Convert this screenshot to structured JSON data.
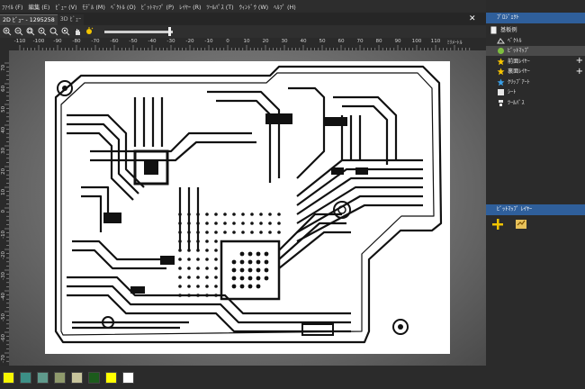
{
  "menubar": [
    "ﾌｧｲﾙ (F)",
    "編集 (E)",
    "ﾋﾞｭｰ (V)",
    "ﾓﾃﾞﾙ (M)",
    "ﾍﾞｸﾄﾙ (O)",
    "ﾋﾞｯﾄﾏｯﾌﾟ (P)",
    "ﾚｲﾔｰ (R)",
    "ﾂｰﾙﾊﾟｽ (T)",
    "ｳｨﾝﾄﾞｳ (W)",
    "ﾍﾙﾌﾟ (H)"
  ],
  "tabs": [
    {
      "label": "2D ﾋﾞｭｰ - 1295258",
      "active": true
    },
    {
      "label": "3D ﾋﾞｭｰ",
      "active": false
    }
  ],
  "ruler": {
    "h_labels": [
      "-110",
      "-100",
      "-90",
      "-80",
      "-70",
      "-60",
      "-50",
      "-40",
      "-30",
      "-20",
      "-10",
      "0",
      "10",
      "20",
      "30",
      "40",
      "50",
      "60",
      "70",
      "80",
      "90",
      "100",
      "110",
      "ﾐﾘﾒｰﾄﾙ"
    ],
    "v_labels": [
      "70",
      "60",
      "50",
      "40",
      "30",
      "20",
      "10",
      "0",
      "-10",
      "-20",
      "-30",
      "-40",
      "-50",
      "-60",
      "-70"
    ]
  },
  "project_panel": {
    "title": "ﾌﾟﾛｼﾞｪｸﾄ",
    "items": [
      {
        "label": "基板例",
        "icon": "document-icon",
        "indent": 0,
        "selected": false,
        "plus": false
      },
      {
        "label": "ﾍﾞｸﾄﾙ",
        "icon": "vector-icon",
        "indent": 1,
        "selected": false,
        "plus": false
      },
      {
        "label": "ﾋﾞｯﾄﾏｯﾌﾟ",
        "icon": "bitmap-icon",
        "indent": 1,
        "selected": true,
        "plus": false
      },
      {
        "label": "前面ﾚｲﾔｰ",
        "icon": "star-icon",
        "indent": 1,
        "selected": false,
        "plus": true
      },
      {
        "label": "裏面ﾚｲﾔｰ",
        "icon": "star-icon",
        "indent": 1,
        "selected": false,
        "plus": true
      },
      {
        "label": "ｸﾘｯﾌﾟｱｰﾄ",
        "icon": "star-blue-icon",
        "indent": 1,
        "selected": false,
        "plus": false
      },
      {
        "label": "ｼｰﾄ",
        "icon": "sheet-icon",
        "indent": 1,
        "selected": false,
        "plus": false
      },
      {
        "label": "ﾂｰﾙﾊﾟｽ",
        "icon": "toolpath-icon",
        "indent": 1,
        "selected": false,
        "plus": false
      }
    ]
  },
  "layers_panel": {
    "title": "ﾋﾞｯﾄﾏｯﾌﾟ ﾚｲﾔｰ"
  },
  "swatches": [
    "#f6f600",
    "#3c8f86",
    "#5f9a8c",
    "#8f9a6c",
    "#c7c49c",
    "#1c5b1c",
    "#ffff00",
    "#ffffff"
  ],
  "colors": {
    "accent": "#2f5f9b",
    "background": "#2b2b2b",
    "star": "#f6c400"
  }
}
